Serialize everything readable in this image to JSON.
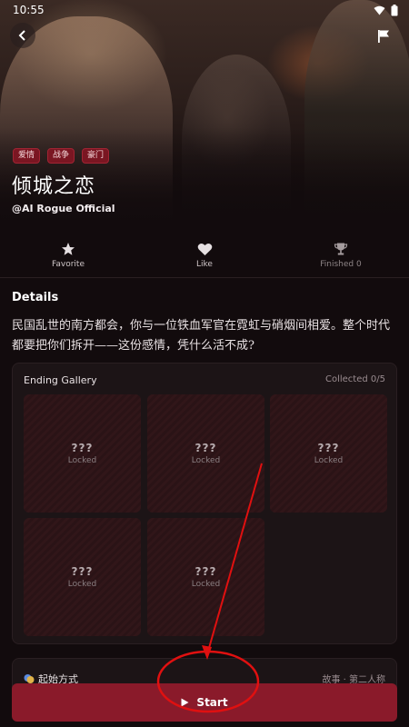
{
  "status_bar": {
    "time": "10:55"
  },
  "hero": {
    "tags": [
      "爱情",
      "战争",
      "豪门"
    ],
    "title": "倾城之恋",
    "author": "@AI Rogue Official"
  },
  "actions": [
    {
      "icon": "star-icon",
      "label": "Favorite"
    },
    {
      "icon": "heart-icon",
      "label": "Like"
    },
    {
      "icon": "trophy-icon",
      "label": "Finished 0"
    }
  ],
  "details": {
    "heading": "Details",
    "text": "民国乱世的南方都会，你与一位铁血军官在霓虹与硝烟间相爱。整个时代都要把你们拆开——这份感情，凭什么活不成?"
  },
  "gallery": {
    "title": "Ending Gallery",
    "collected": "Collected 0/5",
    "cards": [
      {
        "q": "???",
        "status": "Locked"
      },
      {
        "q": "???",
        "status": "Locked"
      },
      {
        "q": "???",
        "status": "Locked"
      },
      {
        "q": "???",
        "status": "Locked"
      },
      {
        "q": "???",
        "status": "Locked"
      }
    ]
  },
  "start_method": {
    "label": "起始方式",
    "value": "故事 · 第二人称"
  },
  "start_button": {
    "label": "Start"
  },
  "colors": {
    "accent": "#8a1a2a",
    "tag_bg": "#7a1622",
    "annotation": "#e01010"
  }
}
